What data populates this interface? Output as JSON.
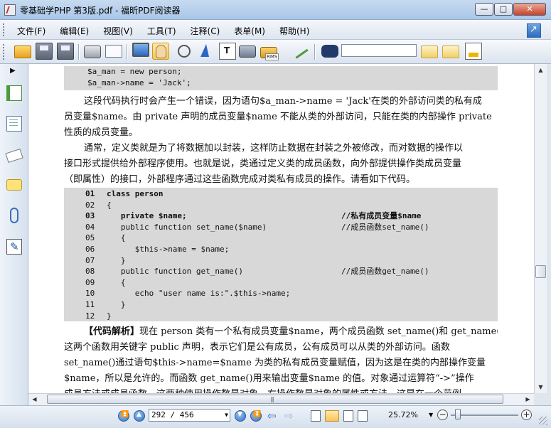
{
  "window": {
    "title": "零基础学PHP  第3版.pdf - 福昕PDF阅读器",
    "min_label": "—",
    "max_label": "□",
    "close_label": "✕"
  },
  "menu": {
    "items": [
      {
        "label": "文件(F)"
      },
      {
        "label": "编辑(E)"
      },
      {
        "label": "视图(V)"
      },
      {
        "label": "工具(T)"
      },
      {
        "label": "注释(C)"
      },
      {
        "label": "表单(M)"
      },
      {
        "label": "帮助(H)"
      }
    ]
  },
  "toolbar": {
    "rms_label": "RMS",
    "find_value": "",
    "active_tool": "hand-tool"
  },
  "document": {
    "code1": [
      "$a_man = new person;",
      "$a_man->name = 'Jack';"
    ],
    "p1": [
      "这段代码执行时会产生一个错误，因为语句$a_man->name = 'Jack'在类的外部访问类的私有成",
      "员变量$name。由 private 声明的成员变量$name 不能从类的外部访问，只能在类的内部操作 private",
      "性质的成员变量。"
    ],
    "p2": [
      "通常，定义类就是为了将数据加以封装，这样防止数据在封装之外被修改，而对数据的操作以",
      "接口形式提供给外部程序使用。也就是说，类通过定义类的成员函数，向外部提供操作类成员变量",
      "（即属性）的接口，外部程序通过这些函数完成对类私有成员的操作。请看如下代码。"
    ],
    "code2": [
      {
        "n": "01",
        "code": "class person",
        "comment": "",
        "bold": true
      },
      {
        "n": "02",
        "code": "{",
        "comment": "",
        "bold": false
      },
      {
        "n": "03",
        "code": "   private $name;",
        "comment": "//私有成员变量$name",
        "bold": true
      },
      {
        "n": "04",
        "code": "   public function set_name($name)",
        "comment": "//成员函数set_name()",
        "bold": false
      },
      {
        "n": "05",
        "code": "   {",
        "comment": "",
        "bold": false
      },
      {
        "n": "06",
        "code": "      $this->name = $name;",
        "comment": "",
        "bold": false
      },
      {
        "n": "07",
        "code": "   }",
        "comment": "",
        "bold": false
      },
      {
        "n": "08",
        "code": "   public function get_name()",
        "comment": "//成员函数get_name()",
        "bold": false
      },
      {
        "n": "09",
        "code": "   {",
        "comment": "",
        "bold": false
      },
      {
        "n": "10",
        "code": "      echo \"user name is:\".$this->name;",
        "comment": "",
        "bold": false
      },
      {
        "n": "11",
        "code": "   }",
        "comment": "",
        "bold": false
      },
      {
        "n": "12",
        "code": "}",
        "comment": "",
        "bold": false
      }
    ],
    "p3_label": "【代码解析】",
    "p3_first": "现在 person 类有一个私有成员变量$name，两个成员函数 set_name()和 get_name()，",
    "p3": [
      "这两个函数用关键字 public 声明，表示它们是公有成员，公有成员可以从类的外部访问。函数",
      "set_name()通过语句$this->name=$name 为类的私有成员变量赋值，因为这是在类的内部操作变量",
      "$name，所以是允许的。而函数 get_name()用来输出变量$name 的值。对象通过运算符“->”操作",
      "成员方法或成员函数，这两种使用操作数是对象，右操作数是对象的属性或方法，这是在一个范例"
    ]
  },
  "status": {
    "page_display": "292 / 456",
    "current_page": 292,
    "total_pages": 456,
    "zoom": "25.72%",
    "zoom_slider_fraction": 0.06
  }
}
